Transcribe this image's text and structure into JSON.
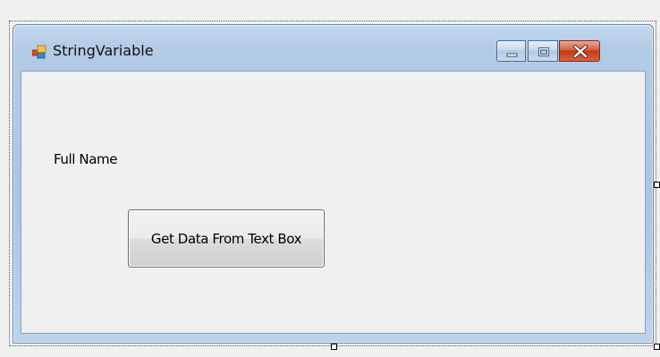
{
  "window": {
    "title": "StringVariable"
  },
  "icons": {
    "app": "form-icon",
    "minimize": "minimize-icon",
    "maximize": "maximize-icon",
    "close": "close-icon"
  },
  "form": {
    "full_name_label": "Full Name",
    "get_data_button_label": "Get Data From Text Box"
  },
  "colors": {
    "client_background": "#f0f0f0",
    "frame": "#a9c4e3",
    "close_button": "#c13a19"
  }
}
